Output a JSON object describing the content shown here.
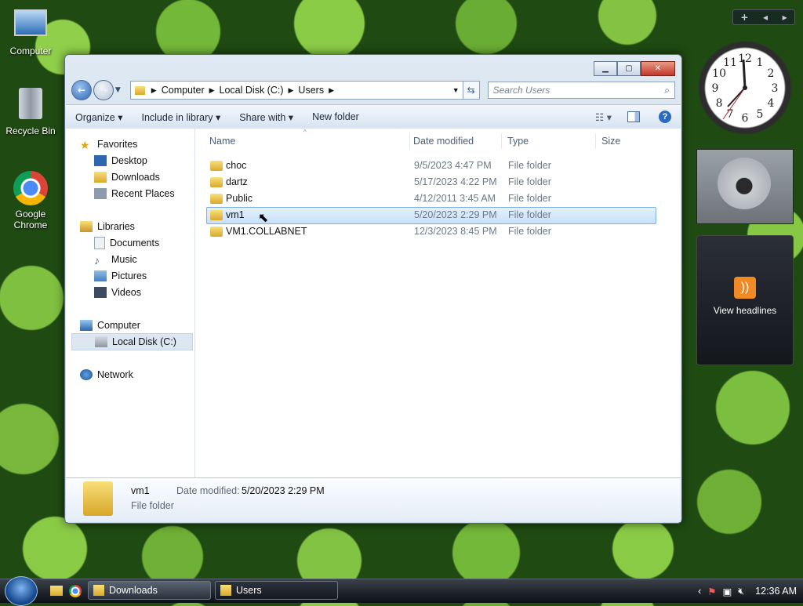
{
  "desktop": {
    "icons": [
      {
        "label": "Computer"
      },
      {
        "label": "Recycle Bin"
      },
      {
        "label": "Google Chrome"
      }
    ]
  },
  "window": {
    "address": {
      "segments": [
        "Computer",
        "Local Disk (C:)",
        "Users"
      ]
    },
    "search_placeholder": "Search Users",
    "toolbar": {
      "organize": "Organize",
      "include_in_library": "Include in library",
      "share_with": "Share with",
      "new_folder": "New folder"
    },
    "nav": {
      "favorites": "Favorites",
      "desktop": "Desktop",
      "downloads": "Downloads",
      "recent_places": "Recent Places",
      "libraries": "Libraries",
      "documents": "Documents",
      "music": "Music",
      "pictures": "Pictures",
      "videos": "Videos",
      "computer": "Computer",
      "local_disk": "Local Disk (C:)",
      "network": "Network"
    },
    "columns": {
      "name": "Name",
      "date_modified": "Date modified",
      "type": "Type",
      "size": "Size"
    },
    "files": [
      {
        "name": "choc",
        "date": "9/5/2023 4:47 PM",
        "type": "File folder"
      },
      {
        "name": "dartz",
        "date": "5/17/2023 4:22 PM",
        "type": "File folder"
      },
      {
        "name": "Public",
        "date": "4/12/2011 3:45 AM",
        "type": "File folder"
      },
      {
        "name": "vm1",
        "date": "5/20/2023 2:29 PM",
        "type": "File folder"
      },
      {
        "name": "VM1.COLLABNET",
        "date": "12/3/2023 8:45 PM",
        "type": "File folder"
      }
    ],
    "details": {
      "name": "vm1",
      "date_label": "Date modified:",
      "date_value": "5/20/2023 2:29 PM",
      "type": "File folder"
    }
  },
  "gadgets": {
    "clock_numbers": [
      "12",
      "1",
      "2",
      "3",
      "4",
      "5",
      "6",
      "7",
      "8",
      "9",
      "10",
      "11"
    ],
    "feed_label": "View headlines",
    "sidebar_add": "+"
  },
  "taskbar": {
    "tasks": [
      {
        "label": "Downloads"
      },
      {
        "label": "Users"
      }
    ],
    "clock": "12:36 AM"
  }
}
